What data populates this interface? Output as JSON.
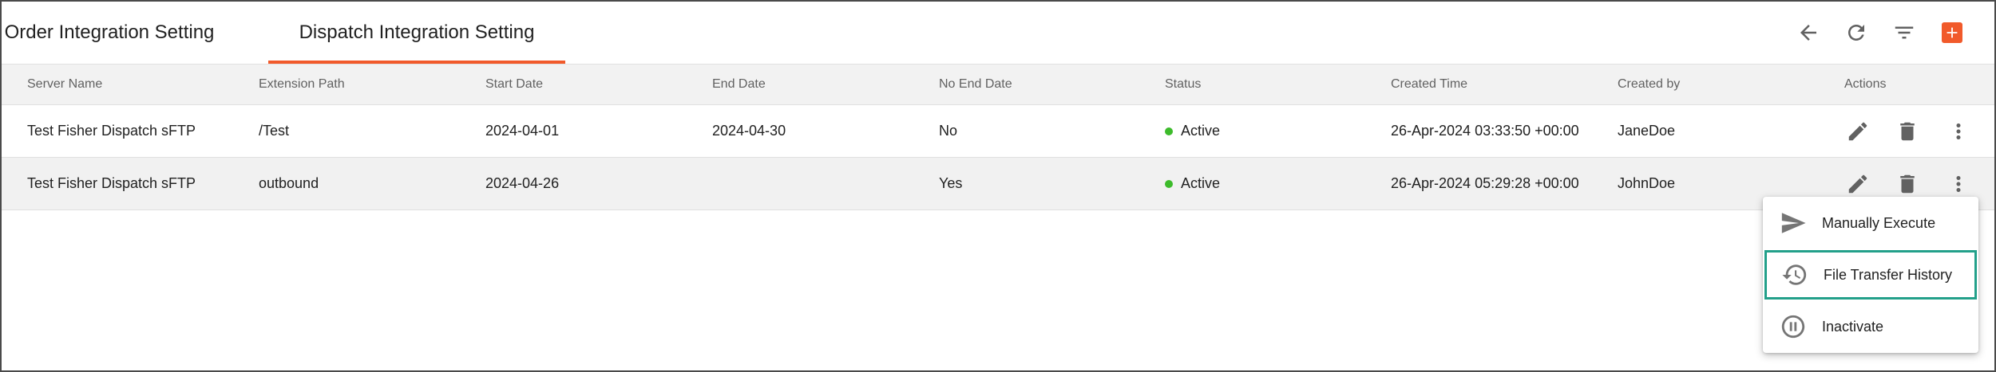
{
  "tabs": [
    {
      "label": "Order Integration Setting"
    },
    {
      "label": "Dispatch Integration Setting"
    }
  ],
  "active_tab": "Dispatch Integration Setting",
  "accent_color": "#f15a2b",
  "status_active_color": "#3dbb2b",
  "highlight_color": "#23a08a",
  "toolbar": {
    "icons": [
      "back-arrow-icon",
      "refresh-icon",
      "filter-icon",
      "add-icon"
    ]
  },
  "table": {
    "headers": [
      "Server Name",
      "Extension Path",
      "Start Date",
      "End Date",
      "No End Date",
      "Status",
      "Created Time",
      "Created by",
      "Actions"
    ],
    "rows": [
      {
        "server_name": "Test Fisher Dispatch sFTP",
        "extension_path": "/Test",
        "start_date": "2024-04-01",
        "end_date": "2024-04-30",
        "no_end_date": "No",
        "status": "Active",
        "created_time": "26-Apr-2024 03:33:50 +00:00",
        "created_by": "JaneDoe"
      },
      {
        "server_name": "Test Fisher Dispatch sFTP",
        "extension_path": "outbound",
        "start_date": "2024-04-26",
        "end_date": "",
        "no_end_date": "Yes",
        "status": "Active",
        "created_time": "26-Apr-2024 05:29:28 +00:00",
        "created_by": "JohnDoe"
      }
    ]
  },
  "menu": {
    "items": [
      {
        "label": "Manually Execute",
        "icon": "send-icon"
      },
      {
        "label": "File Transfer History",
        "icon": "history-icon",
        "selected": true
      },
      {
        "label": "Inactivate",
        "icon": "pause-circle-icon"
      }
    ]
  }
}
